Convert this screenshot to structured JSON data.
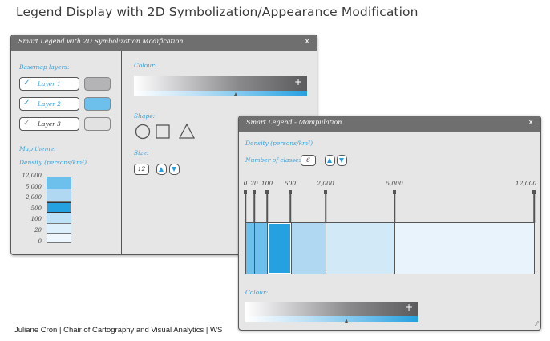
{
  "slide": {
    "title": "Legend Display with 2D Symbolization/Appearance Modification",
    "footer": "Juliane Cron | Chair of Cartography and Visual Analytics | WS"
  },
  "smart_legend": {
    "title": "Smart Legend with 2D Symbolization Modification",
    "close": "x",
    "basemap_label": "Basemap layers:",
    "layers": [
      {
        "name": "Layer 1",
        "checked": true,
        "check_glyph": "✓",
        "swatch_color": "#b4b4b6"
      },
      {
        "name": "Layer 2",
        "checked": true,
        "check_glyph": "✓",
        "swatch_color": "#6ec0ec"
      },
      {
        "name": "Layer 3",
        "checked": false,
        "check_glyph": "✓",
        "swatch_color": "#e2e2e2"
      }
    ],
    "map_theme_label": "Map theme:",
    "density_label": "Density (persons/km²)",
    "ramp_labels": [
      "12,000",
      "5,000",
      "2,000",
      "500",
      "100",
      "20",
      "0"
    ],
    "colour_label": "Colour:",
    "colour_plus": "+",
    "shape_label": "Shape:",
    "size_label": "Size:",
    "size_value": "12"
  },
  "manipulation": {
    "title": "Smart Legend - Manipulation",
    "close": "x",
    "density_label": "Density (persons/km²)",
    "classes_label": "Number of classes:",
    "classes_value": "6",
    "tick_labels": [
      "0",
      "20",
      "100",
      "500",
      "2,000",
      "5,000",
      "12,000"
    ],
    "colour_label": "Colour:",
    "colour_plus": "+",
    "resize_glyph": "⁄⁄"
  },
  "colors": {
    "accent": "#25a0e0",
    "light_blue": "#6ec0ec",
    "titlebar": "#6f6f70"
  }
}
